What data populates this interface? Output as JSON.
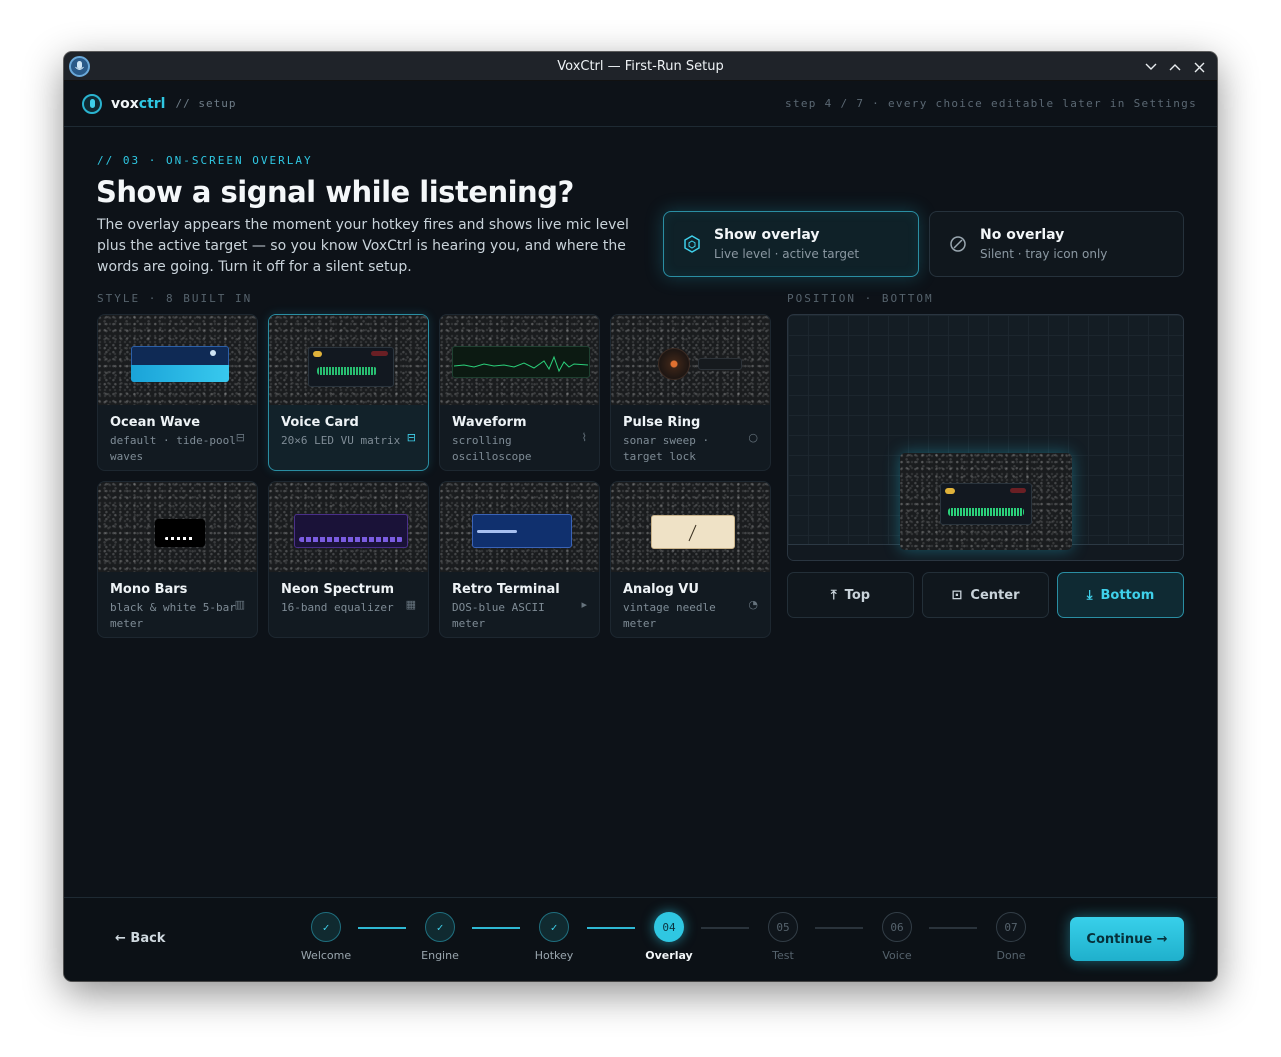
{
  "window": {
    "title": "VoxCtrl — First-Run Setup"
  },
  "header": {
    "brand_prefix": "vox",
    "brand_suffix": "ctrl",
    "crumb": "// setup",
    "step_note": "step 4 / 7 · every choice editable later in Settings"
  },
  "main": {
    "eyebrow": "// 03 · ON-SCREEN OVERLAY",
    "title": "Show a signal while listening?",
    "description": "The overlay appears the moment your hotkey fires and shows live mic level plus the active target — so you know VoxCtrl is hearing you, and where the words are going. Turn it off for a silent setup.",
    "choices": [
      {
        "title": "Show overlay",
        "subtitle": "Live level · active target",
        "icon": "hexagon-icon",
        "selected": true
      },
      {
        "title": "No overlay",
        "subtitle": "Silent · tray icon only",
        "icon": "ban-icon",
        "selected": false
      }
    ],
    "style_label": "STYLE · 8 BUILT IN",
    "styles": [
      {
        "name": "Ocean Wave",
        "sub": "default · tide-pool waves",
        "icon": "sliders-icon",
        "glyph": "⊟",
        "selected": false
      },
      {
        "name": "Voice Card",
        "sub": "20×6 LED VU matrix",
        "icon": "card-icon",
        "glyph": "⊟",
        "selected": true
      },
      {
        "name": "Waveform",
        "sub": "scrolling oscilloscope",
        "icon": "wave-icon",
        "glyph": "⌇",
        "selected": false
      },
      {
        "name": "Pulse Ring",
        "sub": "sonar sweep · target lock",
        "icon": "ring-icon",
        "glyph": "○",
        "selected": false
      },
      {
        "name": "Mono Bars",
        "sub": "black & white 5-bar meter",
        "icon": "bars-icon",
        "glyph": "▥",
        "selected": false
      },
      {
        "name": "Neon Spectrum",
        "sub": "16-band equalizer",
        "icon": "grid-icon",
        "glyph": "▦",
        "selected": false
      },
      {
        "name": "Retro Terminal",
        "sub": "DOS-blue ASCII meter",
        "icon": "terminal-icon",
        "glyph": "▸",
        "selected": false
      },
      {
        "name": "Analog VU",
        "sub": "vintage needle meter",
        "icon": "gauge-icon",
        "glyph": "◔",
        "selected": false
      }
    ],
    "position_label": "POSITION · BOTTOM",
    "positions": [
      {
        "label": "Top",
        "glyph": "⤒",
        "selected": false
      },
      {
        "label": "Center",
        "glyph": "⊡",
        "selected": false
      },
      {
        "label": "Bottom",
        "glyph": "⤓",
        "selected": true
      }
    ]
  },
  "footer": {
    "back_label": "← Back",
    "continue_label": "Continue →",
    "steps": [
      {
        "num": "✓",
        "label": "Welcome",
        "state": "done"
      },
      {
        "num": "✓",
        "label": "Engine",
        "state": "done"
      },
      {
        "num": "✓",
        "label": "Hotkey",
        "state": "done"
      },
      {
        "num": "04",
        "label": "Overlay",
        "state": "current"
      },
      {
        "num": "05",
        "label": "Test",
        "state": "todo"
      },
      {
        "num": "06",
        "label": "Voice",
        "state": "todo"
      },
      {
        "num": "07",
        "label": "Done",
        "state": "todo"
      }
    ]
  },
  "colors": {
    "accent": "#2fc7e2",
    "background": "#0d1218",
    "card": "#121a21"
  }
}
